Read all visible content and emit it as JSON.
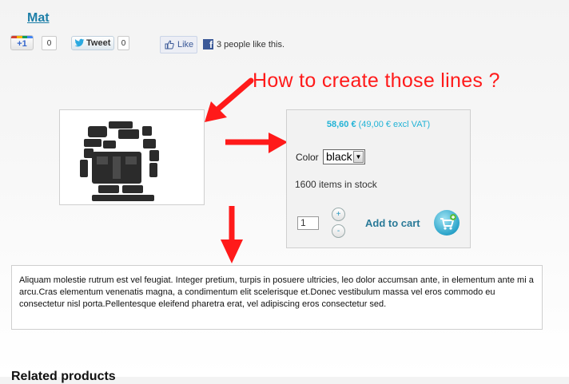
{
  "product": {
    "title": "Mat"
  },
  "social": {
    "gplus_label": "+1",
    "gplus_count": "0",
    "tweet_label": "Tweet",
    "tweet_count": "0",
    "like_label": "Like",
    "like_text": "3 people like this."
  },
  "annotation": {
    "text": "How to create those lines ?"
  },
  "buy_box": {
    "price": "58,60 €",
    "price_excl": "(49,00 € excl VAT)",
    "color_label": "Color",
    "color_value": "black",
    "stock_text": "1600 items in stock",
    "quantity": "1",
    "plus_label": "+",
    "minus_label": "-",
    "add_to_cart_label": "Add to cart"
  },
  "description": {
    "text": "Aliquam molestie rutrum est vel feugiat. Integer pretium, turpis in posuere ultricies, leo dolor accumsan ante, in elementum ante mi a arcu.Cras elementum venenatis magna, a condimentum elit scelerisque et.Donec vestibulum massa vel eros commodo eu consectetur nisl porta.Pellentesque eleifend pharetra erat, vel adipiscing eros consectetur sed."
  },
  "related": {
    "heading": "Related products"
  },
  "icons": {
    "gplus": "google-plus-icon",
    "twitter": "twitter-bird-icon",
    "like": "thumbs-up-icon",
    "facebook": "facebook-icon",
    "cart": "cart-icon",
    "dropdown": "chevron-down-icon"
  },
  "colors": {
    "title_link": "#1d7fa8",
    "price": "#22b3d6",
    "annotation": "#ff1a1a",
    "add_to_cart": "#2a7a98"
  }
}
